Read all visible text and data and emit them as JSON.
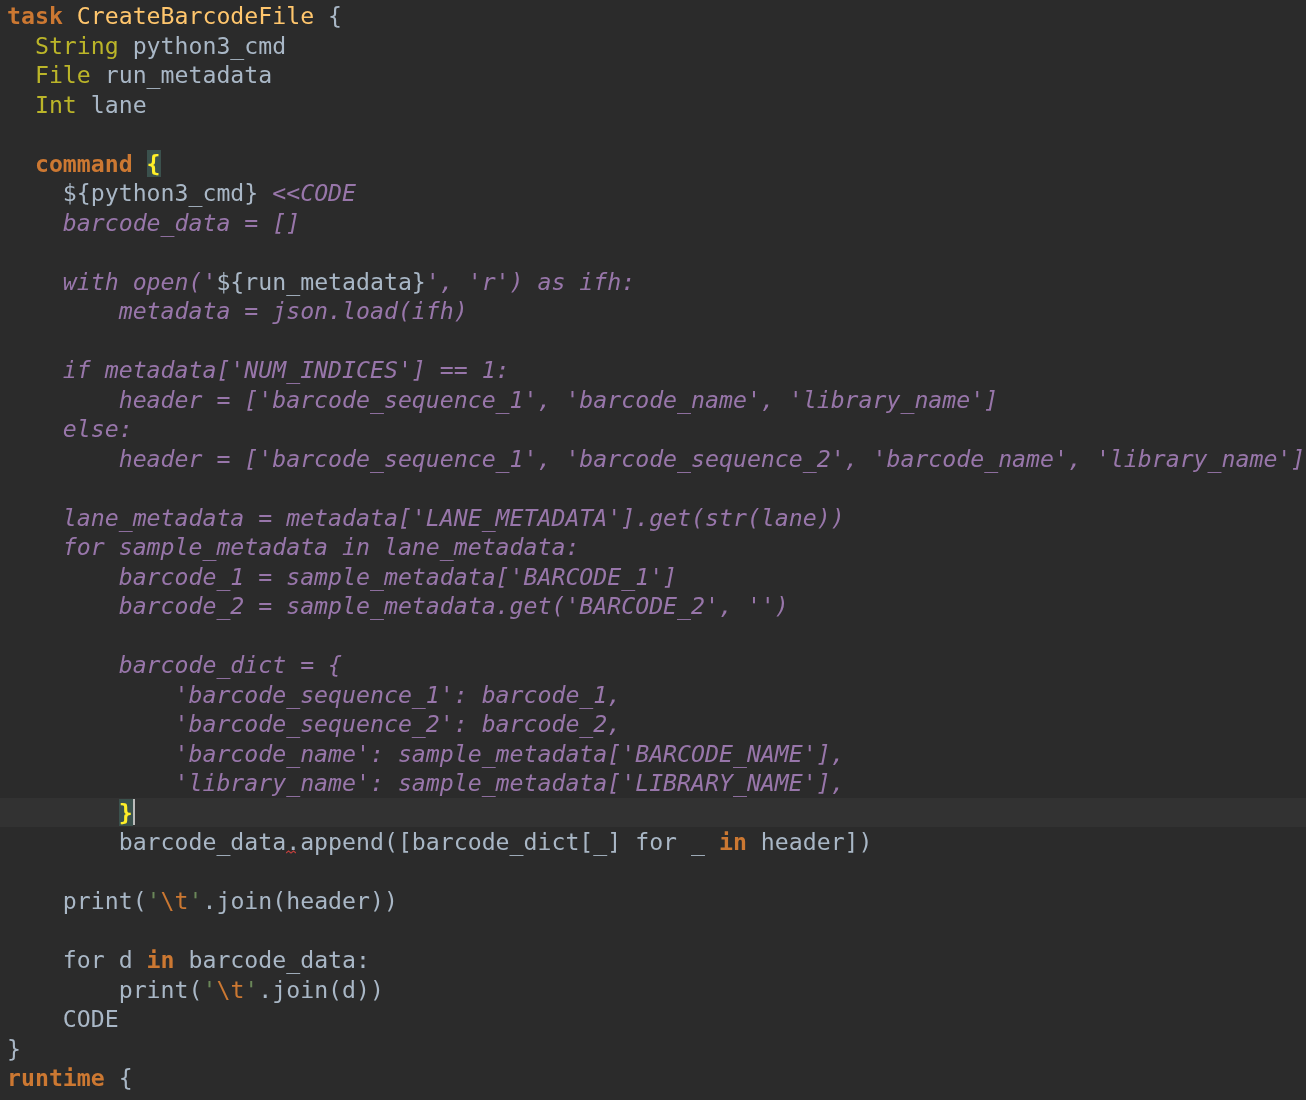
{
  "editor": {
    "lines": [
      {
        "kind": "code",
        "current": false,
        "tokens": [
          {
            "kind": "keyword",
            "text": "task "
          },
          {
            "kind": "name",
            "text": "CreateBarcodeFile"
          },
          {
            "kind": "plain",
            "text": " {"
          }
        ]
      },
      {
        "kind": "code",
        "current": false,
        "tokens": [
          {
            "kind": "type",
            "text": "  String"
          },
          {
            "kind": "plain",
            "text": " python3_cmd"
          }
        ]
      },
      {
        "kind": "code",
        "current": false,
        "tokens": [
          {
            "kind": "type",
            "text": "  File"
          },
          {
            "kind": "plain",
            "text": " run_metadata"
          }
        ]
      },
      {
        "kind": "code",
        "current": false,
        "tokens": [
          {
            "kind": "type",
            "text": "  Int"
          },
          {
            "kind": "plain",
            "text": " lane"
          }
        ]
      },
      {
        "kind": "blank"
      },
      {
        "kind": "code",
        "current": false,
        "tokens": [
          {
            "kind": "keyword",
            "text": "  command "
          },
          {
            "kind": "brace-match",
            "text": "{"
          }
        ]
      },
      {
        "kind": "code",
        "current": false,
        "tokens": [
          {
            "kind": "plain",
            "text": "    ${python3_cmd} "
          },
          {
            "kind": "heredoc",
            "text": "<<CODE"
          }
        ]
      },
      {
        "kind": "code",
        "current": false,
        "tokens": [
          {
            "kind": "heredoc",
            "text": "    barcode_data = []"
          }
        ]
      },
      {
        "kind": "blank"
      },
      {
        "kind": "code",
        "current": false,
        "tokens": [
          {
            "kind": "heredoc",
            "text": "    with open('"
          },
          {
            "kind": "plain",
            "text": "${run_metadata}"
          },
          {
            "kind": "heredoc",
            "text": "', 'r') as ifh:"
          }
        ]
      },
      {
        "kind": "code",
        "current": false,
        "tokens": [
          {
            "kind": "heredoc",
            "text": "        metadata = json.load(ifh)"
          }
        ]
      },
      {
        "kind": "blank"
      },
      {
        "kind": "code",
        "current": false,
        "tokens": [
          {
            "kind": "heredoc",
            "text": "    if metadata['NUM_INDICES'] == 1:"
          }
        ]
      },
      {
        "kind": "code",
        "current": false,
        "tokens": [
          {
            "kind": "heredoc",
            "text": "        header = ['barcode_sequence_1', 'barcode_name', 'library_name']"
          }
        ]
      },
      {
        "kind": "code",
        "current": false,
        "tokens": [
          {
            "kind": "heredoc",
            "text": "    else:"
          }
        ]
      },
      {
        "kind": "code",
        "current": false,
        "tokens": [
          {
            "kind": "heredoc",
            "text": "        header = ['barcode_sequence_1', 'barcode_sequence_2', 'barcode_name', 'library_name']"
          }
        ]
      },
      {
        "kind": "blank"
      },
      {
        "kind": "code",
        "current": false,
        "tokens": [
          {
            "kind": "heredoc",
            "text": "    lane_metadata = metadata['LANE_METADATA'].get(str(lane))"
          }
        ]
      },
      {
        "kind": "code",
        "current": false,
        "tokens": [
          {
            "kind": "heredoc",
            "text": "    for sample_metadata in lane_metadata:"
          }
        ]
      },
      {
        "kind": "code",
        "current": false,
        "tokens": [
          {
            "kind": "heredoc",
            "text": "        barcode_1 = sample_metadata['BARCODE_1']"
          }
        ]
      },
      {
        "kind": "code",
        "current": false,
        "tokens": [
          {
            "kind": "heredoc",
            "text": "        barcode_2 = sample_metadata.get('BARCODE_2', '')"
          }
        ]
      },
      {
        "kind": "blank"
      },
      {
        "kind": "code",
        "current": false,
        "tokens": [
          {
            "kind": "heredoc",
            "text": "        barcode_dict = {"
          }
        ]
      },
      {
        "kind": "code",
        "current": false,
        "tokens": [
          {
            "kind": "heredoc",
            "text": "            'barcode_sequence_1': barcode_1,"
          }
        ]
      },
      {
        "kind": "code",
        "current": false,
        "tokens": [
          {
            "kind": "heredoc",
            "text": "            'barcode_sequence_2': barcode_2,"
          }
        ]
      },
      {
        "kind": "code",
        "current": false,
        "tokens": [
          {
            "kind": "heredoc",
            "text": "            'barcode_name': sample_metadata['BARCODE_NAME'],"
          }
        ]
      },
      {
        "kind": "code",
        "current": false,
        "tokens": [
          {
            "kind": "heredoc",
            "text": "            'library_name': sample_metadata['LIBRARY_NAME'],"
          }
        ]
      },
      {
        "kind": "code",
        "current": true,
        "tokens": [
          {
            "kind": "brace-match",
            "text": "        }"
          }
        ]
      },
      {
        "kind": "code",
        "current": false,
        "tokens": [
          {
            "kind": "plain",
            "text": "        barcode_data"
          },
          {
            "kind": "warning",
            "text": ".append([barcode_dict[_] for _ "
          },
          {
            "kind": "keyword",
            "text": "in"
          },
          {
            "kind": "plain",
            "text": " header])"
          }
        ]
      },
      {
        "kind": "blank"
      },
      {
        "kind": "code",
        "current": false,
        "tokens": [
          {
            "kind": "plain",
            "text": "    print("
          },
          {
            "kind": "string",
            "text": "'"
          },
          {
            "kind": "escape",
            "text": "\\t"
          },
          {
            "kind": "string",
            "text": "'"
          },
          {
            "kind": "plain",
            "text": ".join(header))"
          }
        ]
      },
      {
        "kind": "blank"
      },
      {
        "kind": "code",
        "current": false,
        "tokens": [
          {
            "kind": "plain",
            "text": "    for d "
          },
          {
            "kind": "keyword",
            "text": "in"
          },
          {
            "kind": "plain",
            "text": " barcode_data:"
          }
        ]
      },
      {
        "kind": "code",
        "current": false,
        "tokens": [
          {
            "kind": "plain",
            "text": "        print("
          },
          {
            "kind": "string",
            "text": "'"
          },
          {
            "kind": "escape",
            "text": "\\t"
          },
          {
            "kind": "string",
            "text": "'"
          },
          {
            "kind": "plain",
            "text": ".join(d))"
          }
        ]
      },
      {
        "kind": "code",
        "current": false,
        "tokens": [
          {
            "kind": "plain",
            "text": "    CODE"
          }
        ]
      },
      {
        "kind": "code",
        "current": false,
        "tokens": [
          {
            "kind": "plain",
            "text": "}"
          }
        ]
      },
      {
        "kind": "code",
        "current": false,
        "tokens": [
          {
            "kind": "keyword",
            "text": "runtime"
          },
          {
            "kind": "plain",
            "text": " {"
          }
        ]
      }
    ]
  }
}
